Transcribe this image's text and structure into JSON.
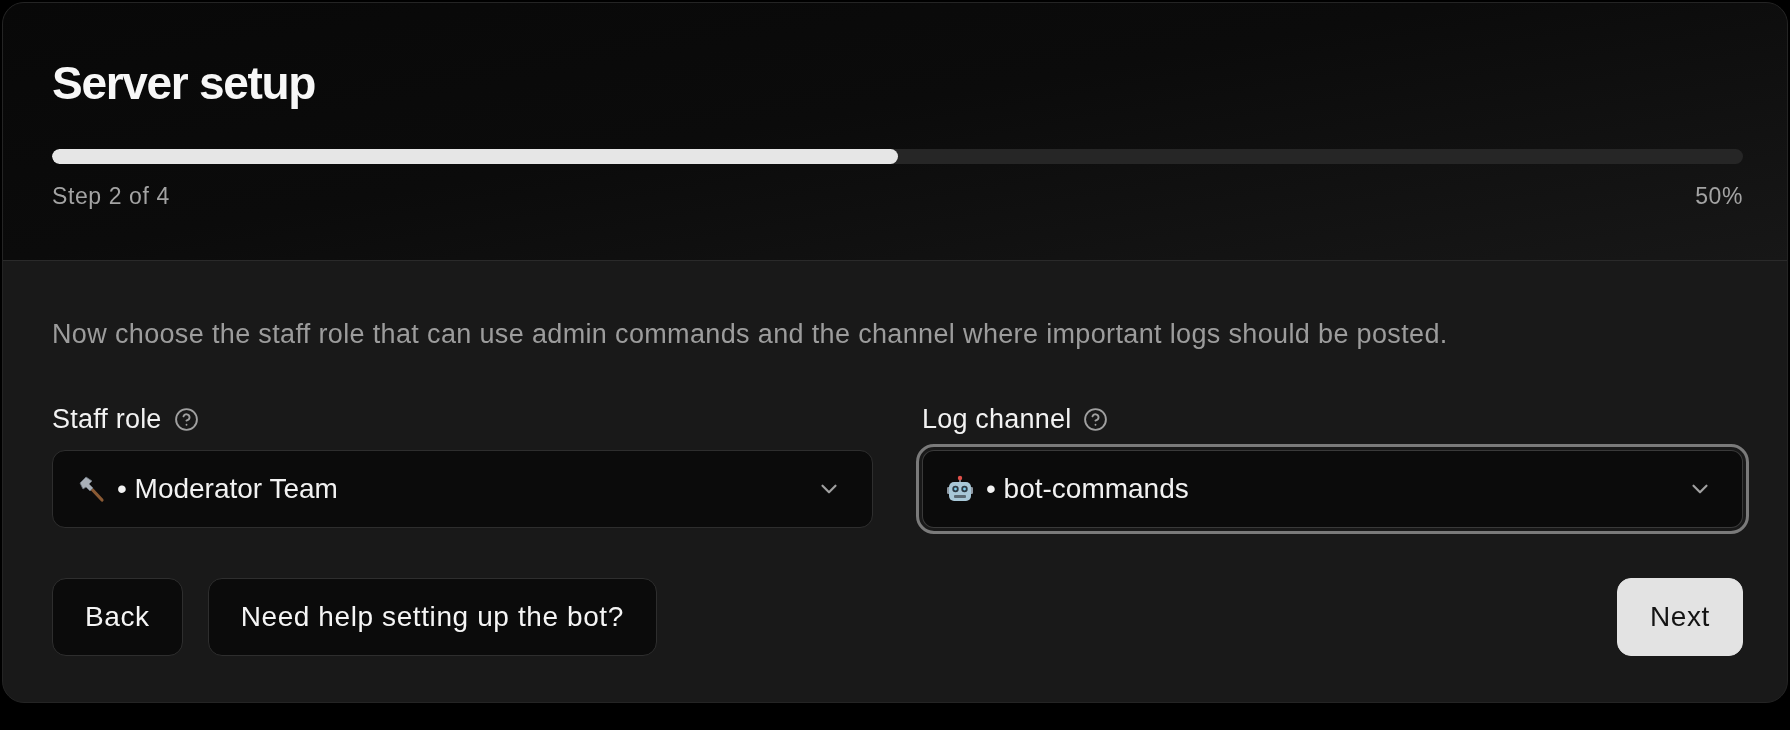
{
  "header": {
    "title": "Server setup",
    "progress": {
      "level": 0.5,
      "step": "Step 2 of 4",
      "percent": "50%"
    }
  },
  "description": "Now choose the staff role that can use admin commands and the channel where important logs should be posted.",
  "fields": [
    {
      "label": "Staff role",
      "value": "• Moderator Team",
      "focused": false
    },
    {
      "label": "Log channel",
      "value": "• bot-commands",
      "focused": true
    }
  ],
  "buttons": [
    {
      "label": "Back",
      "kind": "secondary"
    },
    {
      "label": "Need help setting up the bot?",
      "kind": "secondary"
    },
    {
      "label": "Next",
      "kind": "primary"
    }
  ]
}
